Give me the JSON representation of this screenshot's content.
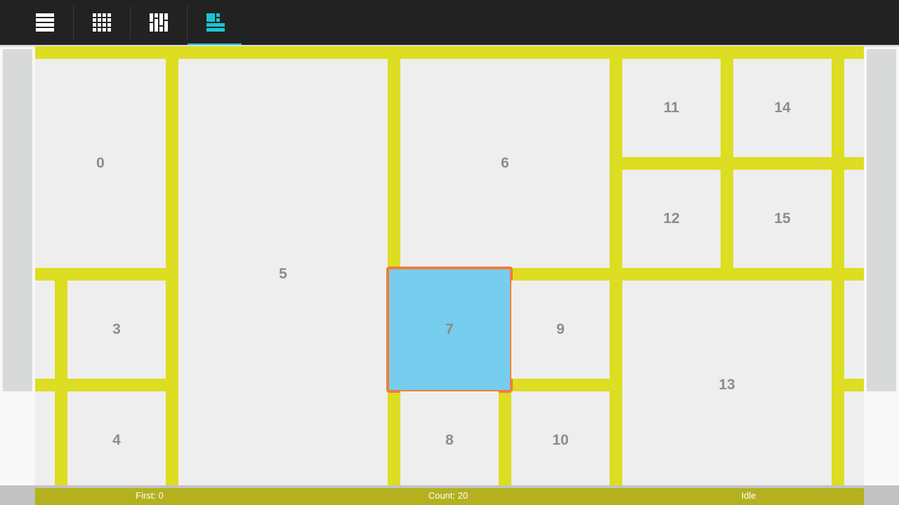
{
  "toolbar": {
    "buttons": [
      {
        "name": "list-view-button",
        "icon": "list-icon"
      },
      {
        "name": "grid-view-button",
        "icon": "grid-icon"
      },
      {
        "name": "staggered-view-button",
        "icon": "staggered-grid-icon"
      },
      {
        "name": "spannable-view-button",
        "icon": "spannable-grid-icon"
      }
    ],
    "active_index": 3,
    "colors": {
      "background": "#222222",
      "icon": "#ffffff",
      "active": "#19c6d6"
    }
  },
  "grid": {
    "colors": {
      "divider": "#dddd22",
      "cell": "#eeeeee",
      "selected_fill": "#77cdee",
      "selected_border": "#f07d3a",
      "label": "#8c8c8c"
    },
    "cells": [
      "0",
      "3",
      "4",
      "5",
      "6",
      "7",
      "8",
      "9",
      "10",
      "11",
      "12",
      "13",
      "14",
      "15"
    ],
    "selected": "7"
  },
  "status": {
    "first": "First: 0",
    "count": "Count: 20",
    "state": "Idle"
  }
}
